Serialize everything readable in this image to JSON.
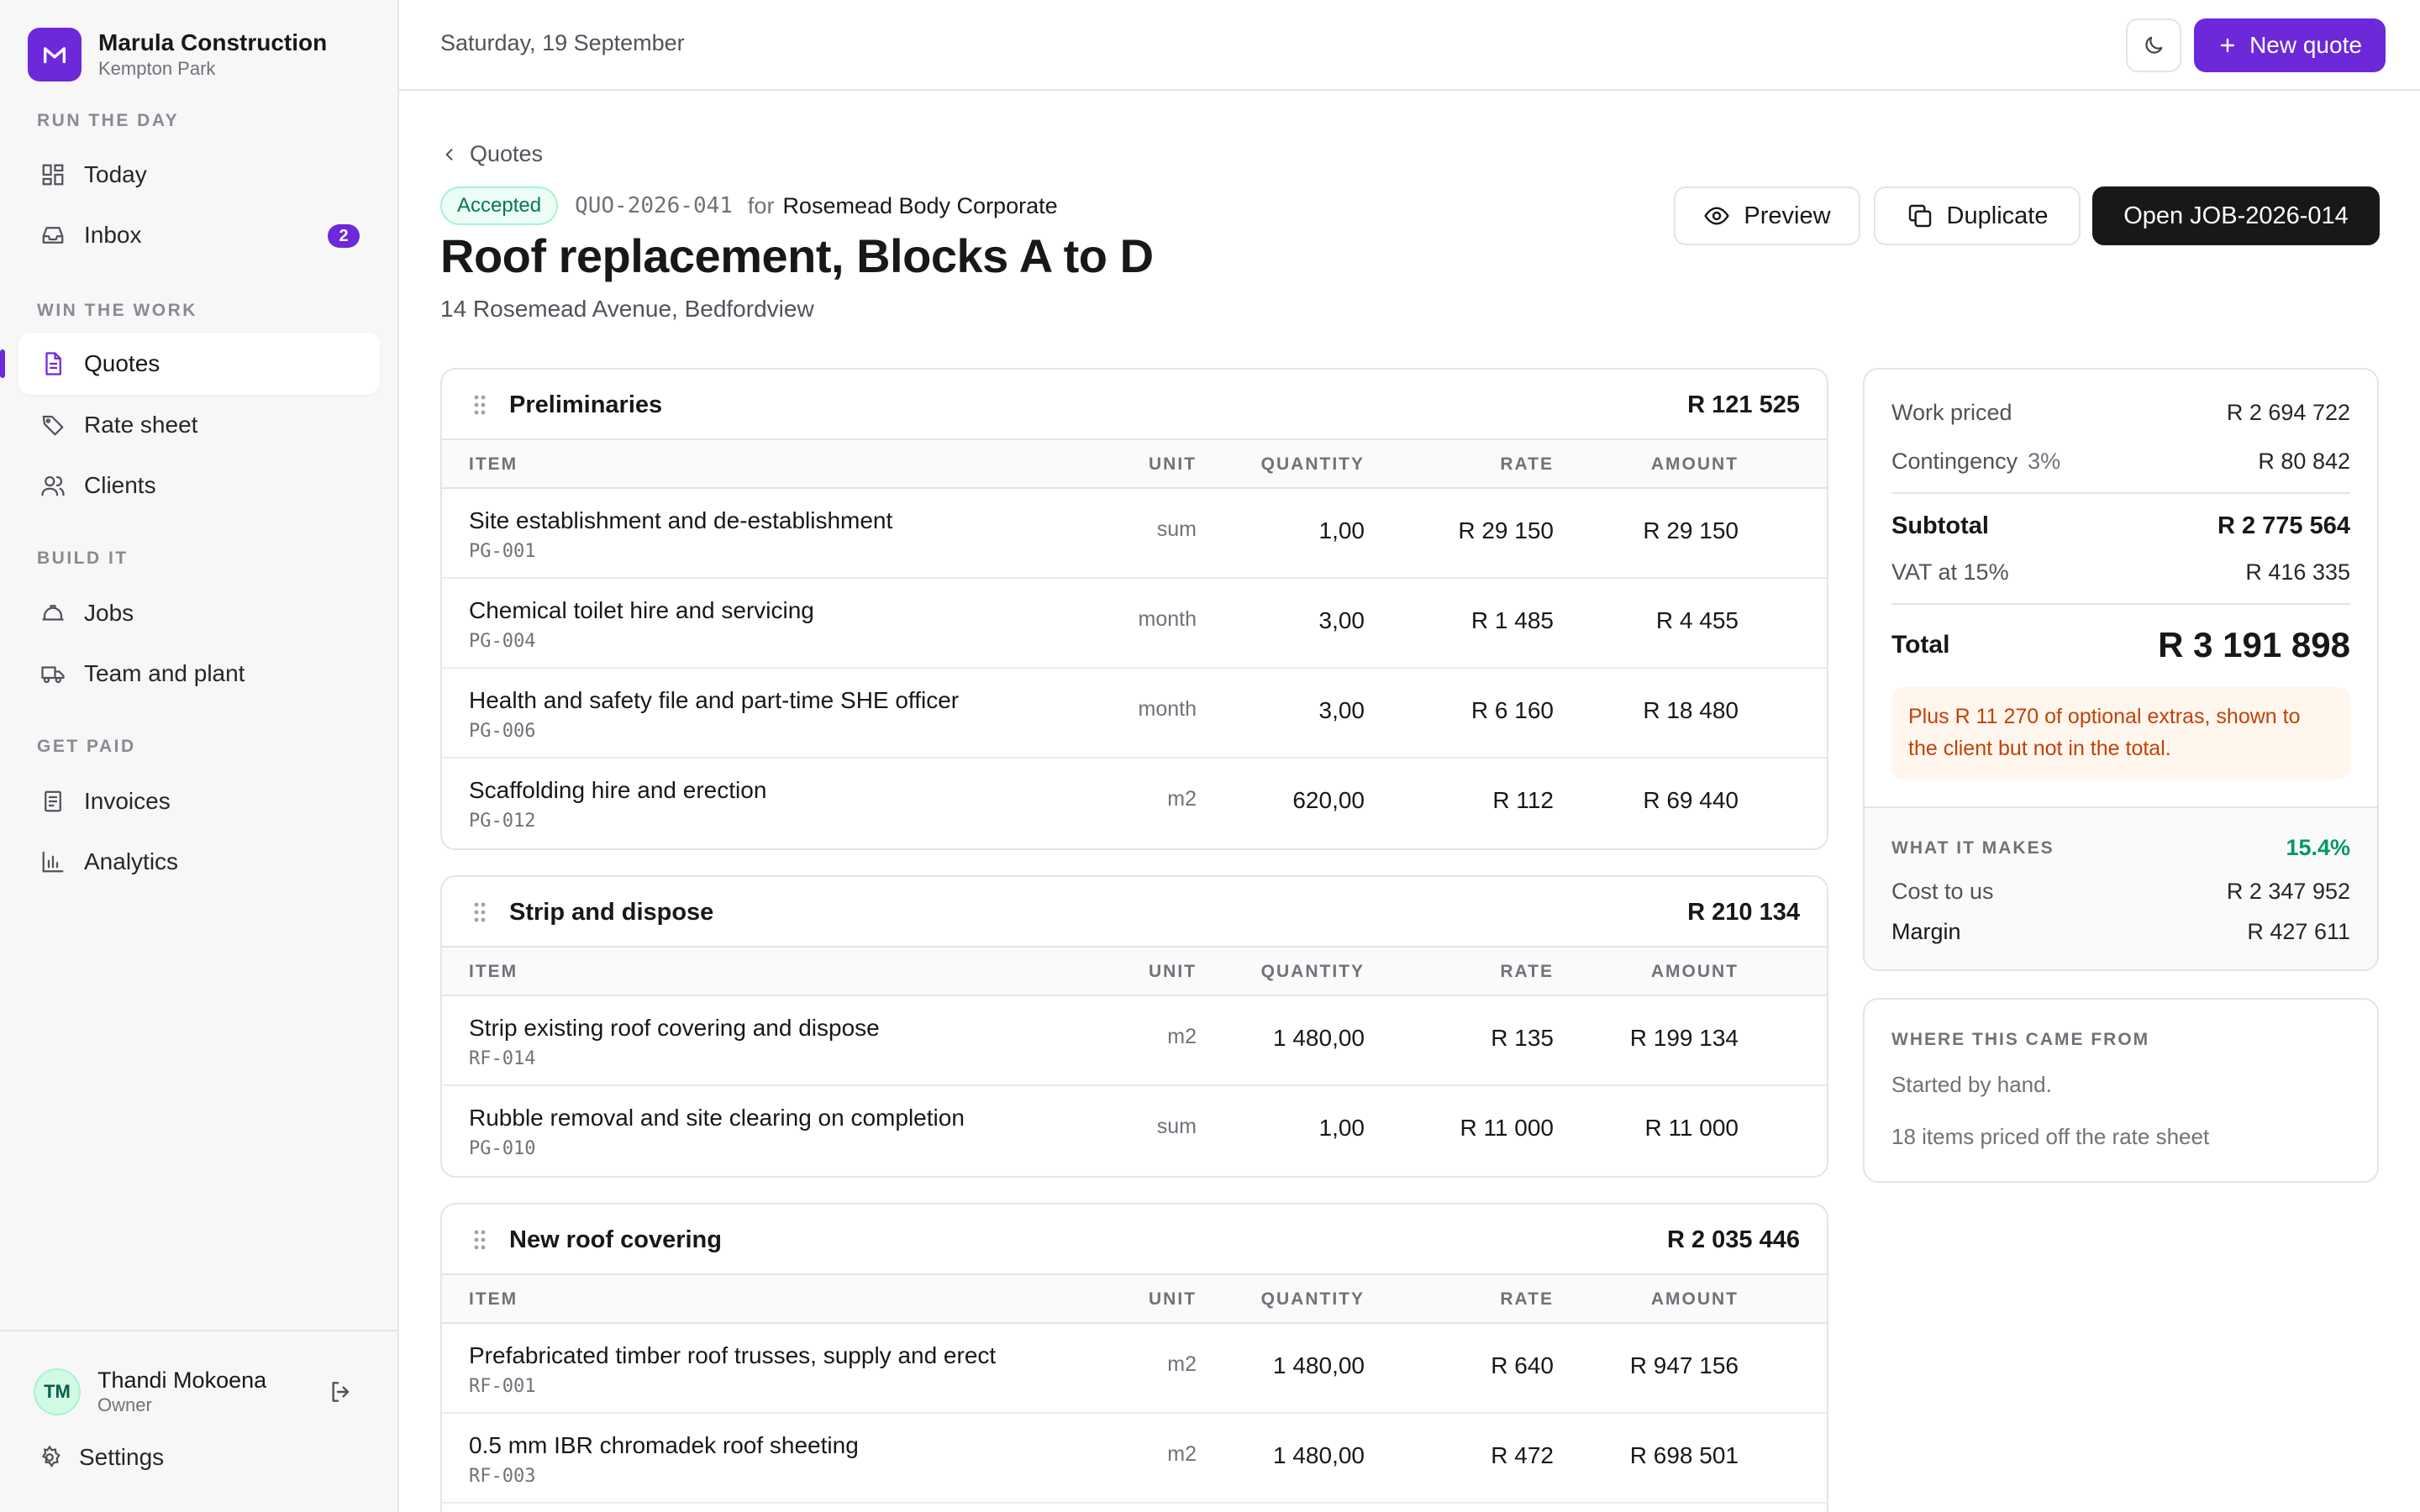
{
  "brand": {
    "name": "Marula Construction",
    "location": "Kempton Park",
    "accent": "#6d28d9"
  },
  "sidebar": {
    "sections": [
      {
        "title": "RUN THE DAY",
        "items": [
          {
            "label": "Today",
            "icon": "dashboard-icon"
          },
          {
            "label": "Inbox",
            "icon": "inbox-icon",
            "badge": "2"
          }
        ]
      },
      {
        "title": "WIN THE WORK",
        "items": [
          {
            "label": "Quotes",
            "icon": "document-icon",
            "active": true
          },
          {
            "label": "Rate sheet",
            "icon": "tag-icon"
          },
          {
            "label": "Clients",
            "icon": "users-icon"
          }
        ]
      },
      {
        "title": "BUILD IT",
        "items": [
          {
            "label": "Jobs",
            "icon": "hardhat-icon"
          },
          {
            "label": "Team and plant",
            "icon": "truck-icon"
          }
        ]
      },
      {
        "title": "GET PAID",
        "items": [
          {
            "label": "Invoices",
            "icon": "receipt-icon"
          },
          {
            "label": "Analytics",
            "icon": "bar-chart-icon"
          }
        ]
      }
    ],
    "user": {
      "initials": "TM",
      "name": "Thandi Mokoena",
      "role": "Owner"
    },
    "settings_label": "Settings"
  },
  "topbar": {
    "date": "Saturday, 19 September",
    "new_quote_label": "New quote"
  },
  "quote": {
    "breadcrumb": "Quotes",
    "status": "Accepted",
    "reference": "QUO-2026-041",
    "for_label": "for",
    "client": "Rosemead Body Corporate",
    "title": "Roof replacement, Blocks A to D",
    "address": "14 Rosemead Avenue, Bedfordview",
    "actions": {
      "preview": "Preview",
      "duplicate": "Duplicate",
      "open_job": "Open JOB-2026-014"
    }
  },
  "columns": {
    "item": "ITEM",
    "unit": "UNIT",
    "quantity": "QUANTITY",
    "rate": "RATE",
    "amount": "AMOUNT"
  },
  "sections": [
    {
      "name": "Preliminaries",
      "total": "R 121 525",
      "rows": [
        {
          "desc": "Site establishment and de-establishment",
          "code": "PG-001",
          "unit": "sum",
          "qty": "1,00",
          "rate": "R 29 150",
          "amount": "R 29 150"
        },
        {
          "desc": "Chemical toilet hire and servicing",
          "code": "PG-004",
          "unit": "month",
          "qty": "3,00",
          "rate": "R 1 485",
          "amount": "R 4 455"
        },
        {
          "desc": "Health and safety file and part-time SHE officer",
          "code": "PG-006",
          "unit": "month",
          "qty": "3,00",
          "rate": "R 6 160",
          "amount": "R 18 480"
        },
        {
          "desc": "Scaffolding hire and erection",
          "code": "PG-012",
          "unit": "m2",
          "qty": "620,00",
          "rate": "R 112",
          "amount": "R 69 440"
        }
      ]
    },
    {
      "name": "Strip and dispose",
      "total": "R 210 134",
      "rows": [
        {
          "desc": "Strip existing roof covering and dispose",
          "code": "RF-014",
          "unit": "m2",
          "qty": "1 480,00",
          "rate": "R 135",
          "amount": "R 199 134"
        },
        {
          "desc": "Rubble removal and site clearing on completion",
          "code": "PG-010",
          "unit": "sum",
          "qty": "1,00",
          "rate": "R 11 000",
          "amount": "R 11 000"
        }
      ]
    },
    {
      "name": "New roof covering",
      "total": "R 2 035 446",
      "rows": [
        {
          "desc": "Prefabricated timber roof trusses, supply and erect",
          "code": "RF-001",
          "unit": "m2",
          "qty": "1 480,00",
          "rate": "R 640",
          "amount": "R 947 156"
        },
        {
          "desc": "0.5 mm IBR chromadek roof sheeting",
          "code": "RF-003",
          "unit": "m2",
          "qty": "1 480,00",
          "rate": "R 472",
          "amount": "R 698 501"
        }
      ]
    }
  ],
  "summary": {
    "work_priced_label": "Work priced",
    "work_priced": "R 2 694 722",
    "contingency_label": "Contingency",
    "contingency_pct": "3%",
    "contingency": "R 80 842",
    "subtotal_label": "Subtotal",
    "subtotal": "R 2 775 564",
    "vat_label": "VAT at 15%",
    "vat": "R 416 335",
    "total_label": "Total",
    "total": "R 3 191 898",
    "extras_note": "Plus R 11 270 of optional extras, shown to the client but not in the total.",
    "makes_title": "WHAT IT MAKES",
    "makes_pct": "15.4%",
    "cost_label": "Cost to us",
    "cost": "R 2 347 952",
    "margin_label": "Margin",
    "margin": "R 427 611"
  },
  "source": {
    "title": "WHERE THIS CAME FROM",
    "line1": "Started by hand.",
    "line2": "18 items priced off the rate sheet"
  }
}
